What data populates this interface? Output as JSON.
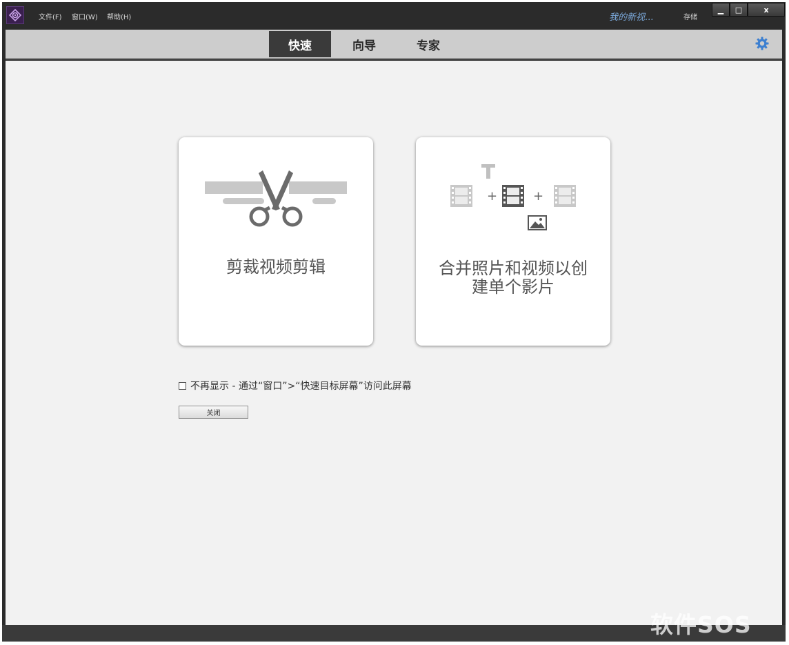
{
  "titlebar": {
    "menus": [
      "文件(F)",
      "窗口(W)",
      "帮助(H)"
    ],
    "project_name": "我的新视...",
    "save_label": "存储",
    "window_buttons": {
      "minimize": "▁",
      "maximize": "□",
      "close": "x"
    }
  },
  "modes": {
    "tabs": [
      "快速",
      "向导",
      "专家"
    ],
    "active": "快速",
    "settings_icon": "gear-icon"
  },
  "cards": [
    {
      "title": "剪裁视频剪辑",
      "icon": "scissors-icon"
    },
    {
      "title_lines": [
        "合并照片和视频以创",
        "建单个影片"
      ],
      "icon": "combine-media-icon"
    }
  ],
  "dont_show": {
    "checked": false,
    "label": "不再显示 - 通过“窗口”>“快速目标屏幕”访问此屏幕"
  },
  "close_button": "关闭",
  "watermark": "软件SOS",
  "colors": {
    "titlebar": "#2b2b2b",
    "modebar": "#cdcdcd",
    "active_tab": "#3a3a3a",
    "content_bg": "#f2f2f2",
    "project_name": "#7aa7d8"
  }
}
